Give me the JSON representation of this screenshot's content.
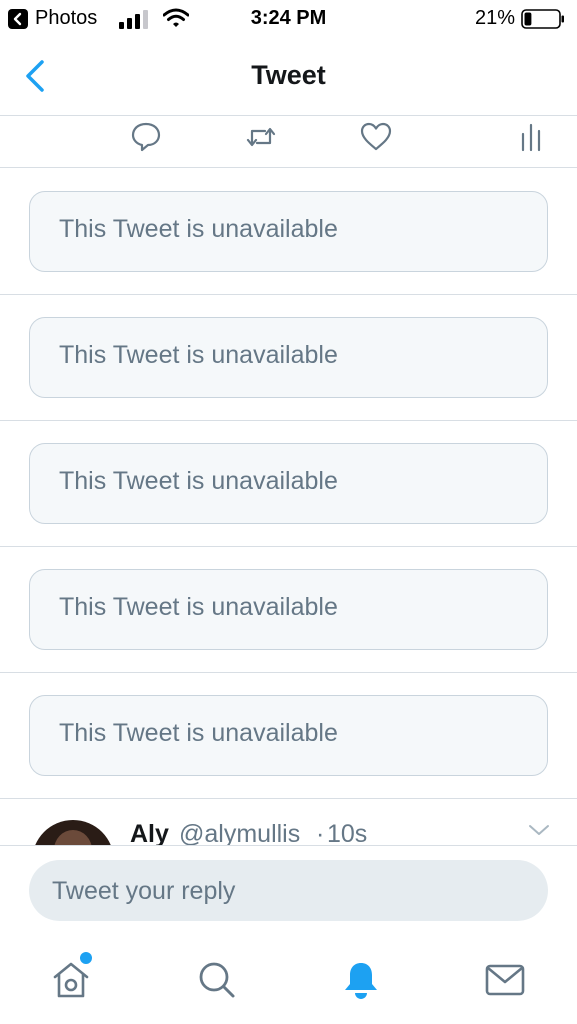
{
  "status_bar": {
    "back_app": "Photos",
    "time": "3:24 PM",
    "battery_percent": "21%",
    "battery_level": 0.21
  },
  "nav": {
    "title": "Tweet",
    "back_icon": "chevron-left-icon",
    "accent_color": "#1da1f2"
  },
  "actions": [
    {
      "icon": "reply-icon"
    },
    {
      "icon": "retweet-icon"
    },
    {
      "icon": "like-icon"
    },
    {
      "icon": "analytics-icon"
    }
  ],
  "unavailable_tweets": [
    {
      "text": "This Tweet is unavailable"
    },
    {
      "text": "This Tweet is unavailable"
    },
    {
      "text": "This Tweet is unavailable"
    },
    {
      "text": "This Tweet is unavailable"
    },
    {
      "text": "This Tweet is unavailable"
    }
  ],
  "partial_tweet": {
    "name": "Aly",
    "handle": "@alymullis",
    "separator": "·",
    "time": "10s"
  },
  "reply": {
    "placeholder": "Tweet your reply"
  },
  "tabs": [
    {
      "icon": "home-icon",
      "has_notification_dot": true
    },
    {
      "icon": "search-icon"
    },
    {
      "icon": "notifications-bell-icon",
      "active": true
    },
    {
      "icon": "messages-envelope-icon"
    }
  ]
}
